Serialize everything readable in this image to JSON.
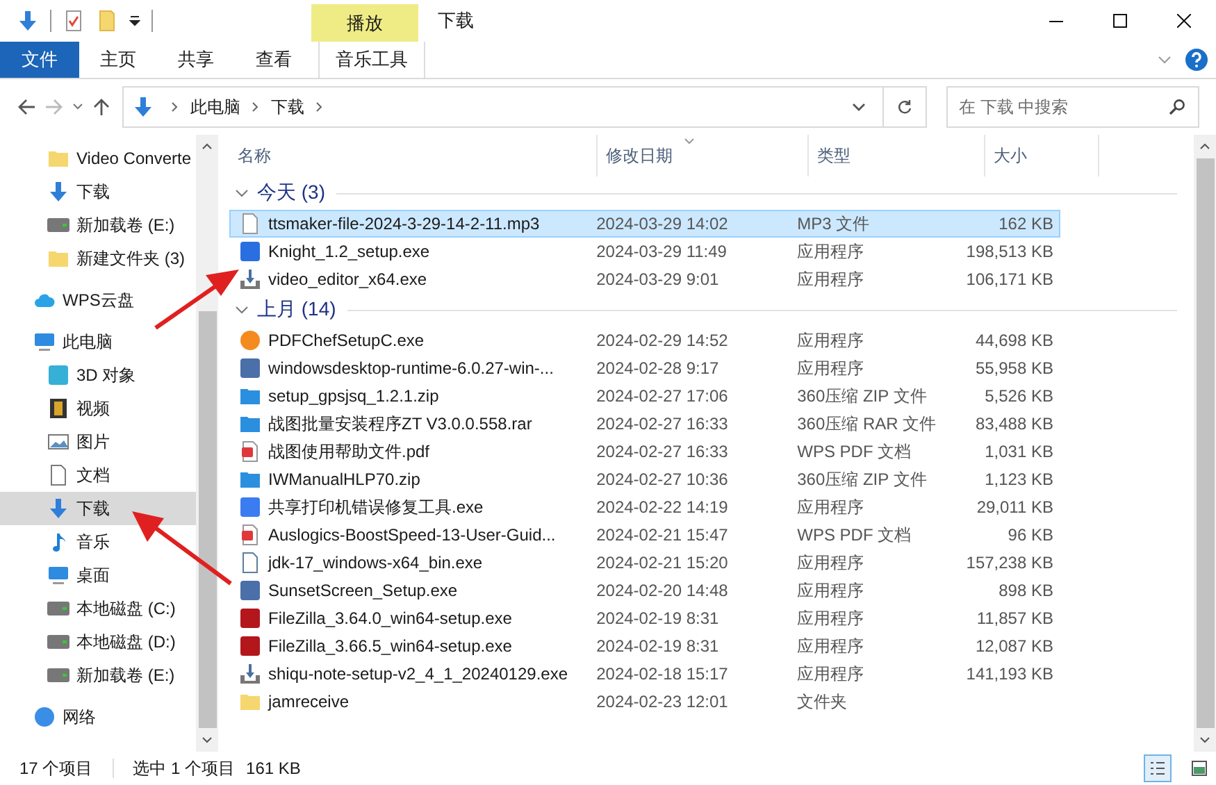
{
  "window": {
    "title": "下载"
  },
  "contextual_tab": {
    "label": "播放"
  },
  "ribbon_tabs": [
    {
      "label": "文件",
      "kind": "file"
    },
    {
      "label": "主页",
      "kind": "normal"
    },
    {
      "label": "共享",
      "kind": "normal"
    },
    {
      "label": "查看",
      "kind": "normal"
    },
    {
      "label": "音乐工具",
      "kind": "contextual"
    }
  ],
  "address_bar": {
    "breadcrumbs": [
      "此电脑",
      "下载"
    ]
  },
  "search": {
    "placeholder": "在 下载 中搜索"
  },
  "sidebar": {
    "pinned": [
      {
        "label": "Video Converte",
        "kind": "folder",
        "selected": false
      },
      {
        "label": "下载",
        "kind": "download",
        "selected": false
      },
      {
        "label": "新加载卷 (E:)",
        "kind": "drive",
        "selected": false
      },
      {
        "label": "新建文件夹 (3)",
        "kind": "folder",
        "selected": false
      }
    ],
    "items": [
      {
        "label": "WPS云盘",
        "kind": "cloud",
        "selected": false
      },
      {
        "label": "此电脑",
        "kind": "pc",
        "selected": false,
        "children": [
          {
            "label": "3D 对象",
            "kind": "cube",
            "selected": false
          },
          {
            "label": "视频",
            "kind": "film",
            "selected": false
          },
          {
            "label": "图片",
            "kind": "picture",
            "selected": false
          },
          {
            "label": "文档",
            "kind": "document",
            "selected": false
          },
          {
            "label": "下载",
            "kind": "download",
            "selected": true
          },
          {
            "label": "音乐",
            "kind": "music",
            "selected": false
          },
          {
            "label": "桌面",
            "kind": "pc",
            "selected": false
          },
          {
            "label": "本地磁盘 (C:)",
            "kind": "drive",
            "selected": false
          },
          {
            "label": "本地磁盘 (D:)",
            "kind": "drive",
            "selected": false
          },
          {
            "label": "新加载卷 (E:)",
            "kind": "drive",
            "selected": false
          }
        ]
      },
      {
        "label": "网络",
        "kind": "network",
        "selected": false
      }
    ]
  },
  "table": {
    "columns": [
      "名称",
      "修改日期",
      "类型",
      "大小"
    ],
    "groups": [
      {
        "label": "今天 (3)",
        "expanded": true,
        "rows": [
          {
            "name": "ttsmaker-file-2024-3-29-14-2-11.mp3",
            "date": "2024-03-29 14:02",
            "type": "MP3 文件",
            "size": "162 KB",
            "kind": "audio",
            "selected": true
          },
          {
            "name": "Knight_1.2_setup.exe",
            "date": "2024-03-29 11:49",
            "type": "应用程序",
            "size": "198,513 KB",
            "kind": "app-blue",
            "selected": false
          },
          {
            "name": "video_editor_x64.exe",
            "date": "2024-03-29 9:01",
            "type": "应用程序",
            "size": "106,171 KB",
            "kind": "installer",
            "selected": false
          }
        ]
      },
      {
        "label": "上月 (14)",
        "expanded": true,
        "rows": [
          {
            "name": "PDFChefSetupC.exe",
            "date": "2024-02-29 14:52",
            "type": "应用程序",
            "size": "44,698 KB",
            "kind": "app-orange",
            "selected": false
          },
          {
            "name": "windowsdesktop-runtime-6.0.27-win-...",
            "date": "2024-02-28 9:17",
            "type": "应用程序",
            "size": "55,958 KB",
            "kind": "setup",
            "selected": false
          },
          {
            "name": "setup_gpsjsq_1.2.1.zip",
            "date": "2024-02-27 17:06",
            "type": "360压缩 ZIP 文件",
            "size": "5,526 KB",
            "kind": "archive",
            "selected": false
          },
          {
            "name": "战图批量安装程序ZT V3.0.0.558.rar",
            "date": "2024-02-27 16:33",
            "type": "360压缩 RAR 文件",
            "size": "83,488 KB",
            "kind": "archive",
            "selected": false
          },
          {
            "name": "战图使用帮助文件.pdf",
            "date": "2024-02-27 16:33",
            "type": "WPS PDF 文档",
            "size": "1,031 KB",
            "kind": "pdf",
            "selected": false
          },
          {
            "name": "IWManualHLP70.zip",
            "date": "2024-02-27 10:36",
            "type": "360压缩 ZIP 文件",
            "size": "1,123 KB",
            "kind": "archive",
            "selected": false
          },
          {
            "name": "共享打印机错误修复工具.exe",
            "date": "2024-02-22 14:19",
            "type": "应用程序",
            "size": "29,011 KB",
            "kind": "printer",
            "selected": false
          },
          {
            "name": "Auslogics-BoostSpeed-13-User-Guid...",
            "date": "2024-02-21 15:47",
            "type": "WPS PDF 文档",
            "size": "96 KB",
            "kind": "pdf",
            "selected": false
          },
          {
            "name": "jdk-17_windows-x64_bin.exe",
            "date": "2024-02-21 15:20",
            "type": "应用程序",
            "size": "157,238 KB",
            "kind": "java",
            "selected": false
          },
          {
            "name": "SunsetScreen_Setup.exe",
            "date": "2024-02-20 14:48",
            "type": "应用程序",
            "size": "898 KB",
            "kind": "setup",
            "selected": false
          },
          {
            "name": "FileZilla_3.64.0_win64-setup.exe",
            "date": "2024-02-19 8:31",
            "type": "应用程序",
            "size": "11,857 KB",
            "kind": "filezilla",
            "selected": false
          },
          {
            "name": "FileZilla_3.66.5_win64-setup.exe",
            "date": "2024-02-19 8:31",
            "type": "应用程序",
            "size": "12,087 KB",
            "kind": "filezilla",
            "selected": false
          },
          {
            "name": "shiqu-note-setup-v2_4_1_20240129.exe",
            "date": "2024-02-18 15:17",
            "type": "应用程序",
            "size": "141,193 KB",
            "kind": "installer",
            "selected": false
          },
          {
            "name": "jamreceive",
            "date": "2024-02-23 12:01",
            "type": "文件夹",
            "kind": "folder",
            "selected": false
          }
        ]
      }
    ]
  },
  "status_bar": {
    "count": "17 个项目",
    "selection": "选中 1 个项目",
    "size": "161 KB",
    "views": [
      {
        "kind": "details",
        "selected": true
      },
      {
        "kind": "tiles",
        "selected": false
      }
    ]
  }
}
